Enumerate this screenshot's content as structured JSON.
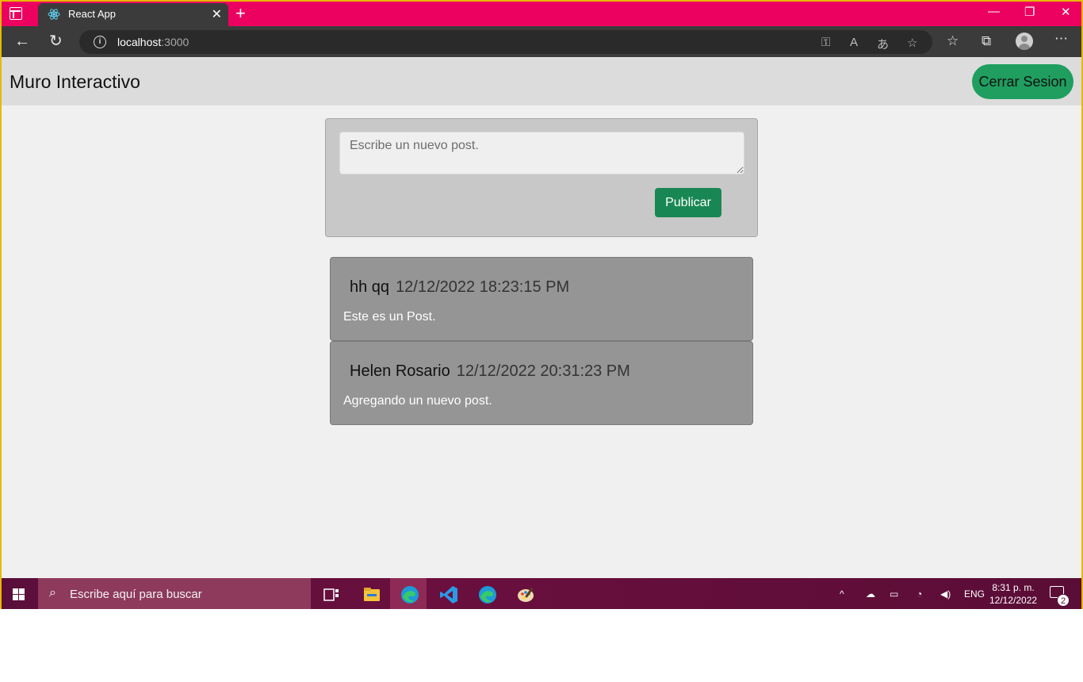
{
  "browser": {
    "tab_title": "React App",
    "url_host": "localhost",
    "url_port": ":3000",
    "accent_color": "#ec0060"
  },
  "app": {
    "title": "Muro Interactivo",
    "logout_label": "Cerrar Sesion"
  },
  "composer": {
    "placeholder": "Escribe un nuevo post.",
    "publish_label": "Publicar"
  },
  "posts": [
    {
      "author": "hh qq",
      "date": "12/12/2022 18:23:15 PM",
      "body": "Este es un Post."
    },
    {
      "author": "Helen Rosario",
      "date": "12/12/2022 20:31:23 PM",
      "body": "Agregando un nuevo post."
    }
  ],
  "taskbar": {
    "search_placeholder": "Escribe aquí para buscar",
    "language": "ENG",
    "time": "8:31 p. m.",
    "date": "12/12/2022",
    "notification_count": "2"
  },
  "icons": [
    "tab-actions-icon",
    "react-icon",
    "close-icon",
    "plus-icon",
    "back-icon",
    "refresh-icon",
    "info-icon",
    "key-icon",
    "read-aloud-icon",
    "translate-icon",
    "add-favorite-icon",
    "favorites-icon",
    "collections-icon",
    "profile-icon",
    "more-icon",
    "windows-icon",
    "search-icon",
    "task-view-icon",
    "file-explorer-icon",
    "edge-icon",
    "vscode-icon",
    "paint-icon",
    "chevron-up-icon",
    "network-icon",
    "battery-icon",
    "wifi-icon",
    "volume-icon",
    "notification-icon"
  ]
}
